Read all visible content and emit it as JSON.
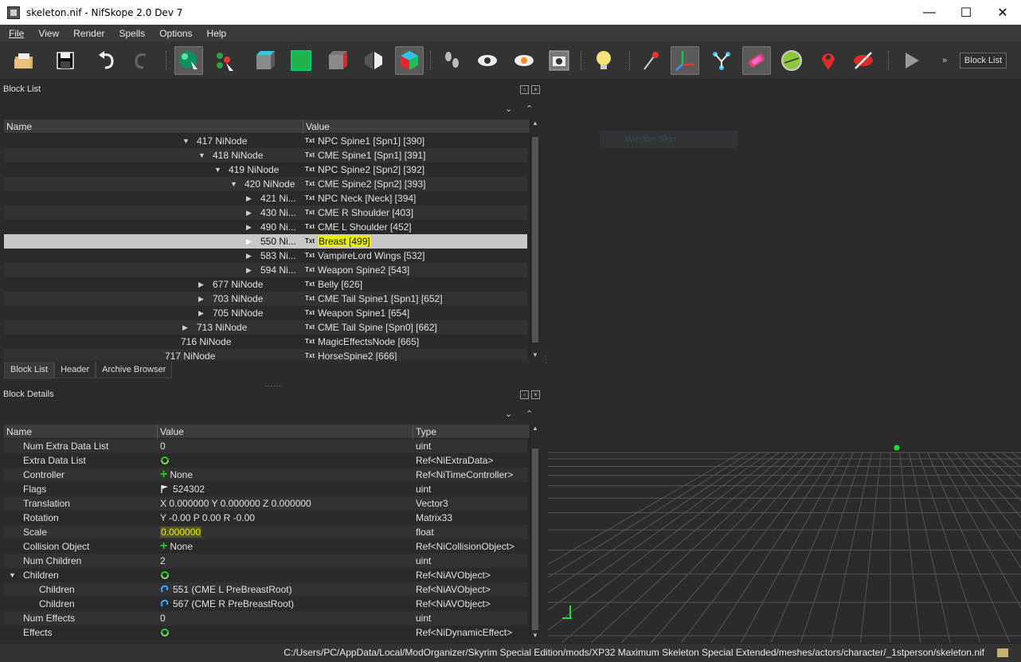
{
  "window": {
    "title": "skeleton.nif - NifSkope 2.0 Dev 7",
    "minimize": "—",
    "maximize": "☐",
    "close": "✕"
  },
  "menu": [
    "File",
    "View",
    "Render",
    "Spells",
    "Options",
    "Help"
  ],
  "toolbar": {
    "icons": [
      "open-icon",
      "save-icon",
      "undo-icon",
      "redo-icon",
      "select-icon",
      "node-select-icon",
      "cube-front-icon",
      "cube-green-icon",
      "cube-side-icon",
      "perspective-icon",
      "cube-color-icon",
      "footprints-icon",
      "eye-icon",
      "eye-hidden-icon",
      "screenshot-icon",
      "light-bulb-icon",
      "vertex-pin-icon",
      "axes-icon",
      "skeleton-icon",
      "texture-icon",
      "grid-icon",
      "marker-icon",
      "hide-icon",
      "play-icon"
    ],
    "overflow": "»",
    "block_list_button": "Block List"
  },
  "block_list": {
    "title": "Block List",
    "columns": [
      "Name",
      "Value"
    ],
    "rows": [
      {
        "name": "417 NiNode",
        "value": "NPC Spine1 [Spn1] [390]",
        "expanded": true
      },
      {
        "name": "418 NiNode",
        "value": "CME Spine1 [Spn1] [391]",
        "expanded": true
      },
      {
        "name": "419 NiNode",
        "value": "NPC Spine2 [Spn2] [392]",
        "expanded": true
      },
      {
        "name": "420 NiNode",
        "value": "CME Spine2 [Spn2] [393]",
        "expanded": true
      },
      {
        "name": "421 Ni...",
        "value": "NPC Neck [Neck] [394]",
        "expanded": false
      },
      {
        "name": "430 Ni...",
        "value": "CME R Shoulder [403]",
        "expanded": false
      },
      {
        "name": "490 Ni...",
        "value": "CME L Shoulder [452]",
        "expanded": false
      },
      {
        "name": "550 Ni...",
        "value": "Breast [499]",
        "expanded": false,
        "selected": true
      },
      {
        "name": "583 Ni...",
        "value": "VampireLord Wings [532]",
        "expanded": false
      },
      {
        "name": "594 Ni...",
        "value": "Weapon Spine2 [543]",
        "expanded": false
      },
      {
        "name": "677 NiNode",
        "value": "Belly [626]",
        "expanded": false
      },
      {
        "name": "703 NiNode",
        "value": "CME Tail Spine1 [Spn1] [652]",
        "expanded": false
      },
      {
        "name": "705 NiNode",
        "value": "Weapon Spine1 [654]",
        "expanded": false
      },
      {
        "name": "713 NiNode",
        "value": "CME Tail Spine [Spn0] [662]",
        "expanded": false
      },
      {
        "name": "716 NiNode",
        "value": "MagicEffectsNode [665]",
        "expanded": null
      },
      {
        "name": "717 NiNode",
        "value": "HorseSpine2 [666]",
        "expanded": null
      }
    ],
    "value_icon": "Txt"
  },
  "tabs": [
    "Block List",
    "Header",
    "Archive Browser"
  ],
  "splitter_grip": "......",
  "block_details": {
    "title": "Block Details",
    "columns": [
      "Name",
      "Value",
      "Type"
    ],
    "rows": [
      {
        "name": "Num Extra Data List",
        "value": "0",
        "type": "uint"
      },
      {
        "name": "Extra Data List",
        "value": "",
        "type": "Ref<NiExtraData>",
        "icon": "refresh-icon"
      },
      {
        "name": "Controller",
        "value": "None",
        "type": "Ref<NiTimeController>",
        "icon": "plus-icon"
      },
      {
        "name": "Flags",
        "value": "524302",
        "type": "uint",
        "icon": "flag-icon"
      },
      {
        "name": "Translation",
        "value": "X 0.000000 Y 0.000000 Z 0.000000",
        "type": "Vector3"
      },
      {
        "name": "Rotation",
        "value": "Y -0.00 P 0.00 R -0.00",
        "type": "Matrix33"
      },
      {
        "name": "Scale",
        "value": "0.000000",
        "type": "float",
        "highlight": true
      },
      {
        "name": "Collision Object",
        "value": "None",
        "type": "Ref<NiCollisionObject>",
        "icon": "plus-icon"
      },
      {
        "name": "Num Children",
        "value": "2",
        "type": "uint"
      },
      {
        "name": "Children",
        "value": "",
        "type": "Ref<NiAVObject>",
        "icon": "refresh-icon",
        "expanded": true
      },
      {
        "name": "Children",
        "value": "551 (CME L PreBreastRoot)",
        "type": "Ref<NiAVObject>",
        "icon": "link-icon",
        "child": true
      },
      {
        "name": "Children",
        "value": "567 (CME R PreBreastRoot)",
        "type": "Ref<NiAVObject>",
        "icon": "link-icon",
        "child": true
      },
      {
        "name": "Num Effects",
        "value": "0",
        "type": "uint"
      },
      {
        "name": "Effects",
        "value": "",
        "type": "Ref<NiDynamicEffect>",
        "icon": "refresh-icon"
      }
    ]
  },
  "viewport": {
    "ghost_label": "Window Skin",
    "background": "#2b2b2b",
    "grid_color": "#555555"
  },
  "status": {
    "path": "C:/Users/PC/AppData/Local/ModOrganizer/Skyrim Special Edition/mods/XP32 Maximum Skeleton Special Extended/meshes/actors/character/_1stperson/skeleton.nif"
  }
}
